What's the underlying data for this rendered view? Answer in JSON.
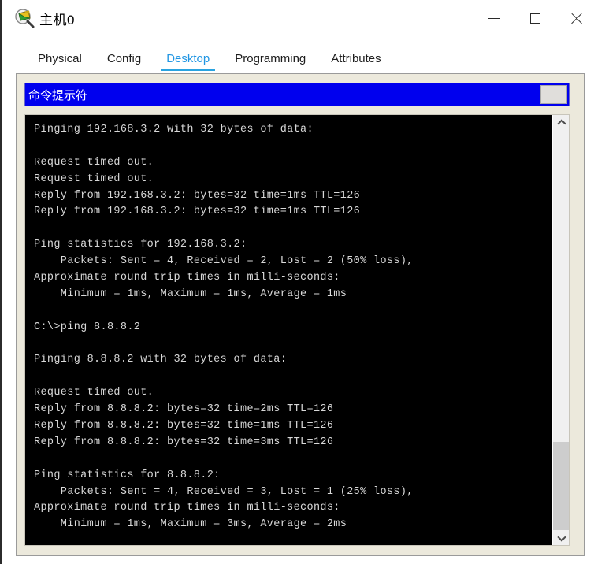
{
  "window": {
    "title": "主机0",
    "icon": "packet-tracer-inspect-icon",
    "controls": {
      "minimize": "—",
      "maximize": "□",
      "close": "✕"
    }
  },
  "tabs": [
    {
      "label": "Physical",
      "active": false
    },
    {
      "label": "Config",
      "active": false
    },
    {
      "label": "Desktop",
      "active": true
    },
    {
      "label": "Programming",
      "active": false
    },
    {
      "label": "Attributes",
      "active": false
    }
  ],
  "app_panel": {
    "header_title": "命令提示符",
    "header_bg": "#0000ee",
    "header_fg": "#ffffff",
    "close_button_label": ""
  },
  "terminal": {
    "background": "#000000",
    "foreground": "#d8d8d8",
    "lines": [
      "Pinging 192.168.3.2 with 32 bytes of data:",
      "",
      "Request timed out.",
      "Request timed out.",
      "Reply from 192.168.3.2: bytes=32 time=1ms TTL=126",
      "Reply from 192.168.3.2: bytes=32 time=1ms TTL=126",
      "",
      "Ping statistics for 192.168.3.2:",
      "    Packets: Sent = 4, Received = 2, Lost = 2 (50% loss),",
      "Approximate round trip times in milli-seconds:",
      "    Minimum = 1ms, Maximum = 1ms, Average = 1ms",
      "",
      "C:\\>ping 8.8.8.2",
      "",
      "Pinging 8.8.8.2 with 32 bytes of data:",
      "",
      "Request timed out.",
      "Reply from 8.8.8.2: bytes=32 time=2ms TTL=126",
      "Reply from 8.8.8.2: bytes=32 time=1ms TTL=126",
      "Reply from 8.8.8.2: bytes=32 time=3ms TTL=126",
      "",
      "Ping statistics for 8.8.8.2:",
      "    Packets: Sent = 4, Received = 3, Lost = 1 (25% loss),",
      "Approximate round trip times in milli-seconds:",
      "    Minimum = 1ms, Maximum = 3ms, Average = 2ms",
      ""
    ],
    "prompt": "C:\\>"
  },
  "scrollbar": {
    "up_arrow": "scroll-up-icon",
    "down_arrow": "scroll-down-icon",
    "thumb_top_pct": 78,
    "thumb_height_pct": 22
  }
}
